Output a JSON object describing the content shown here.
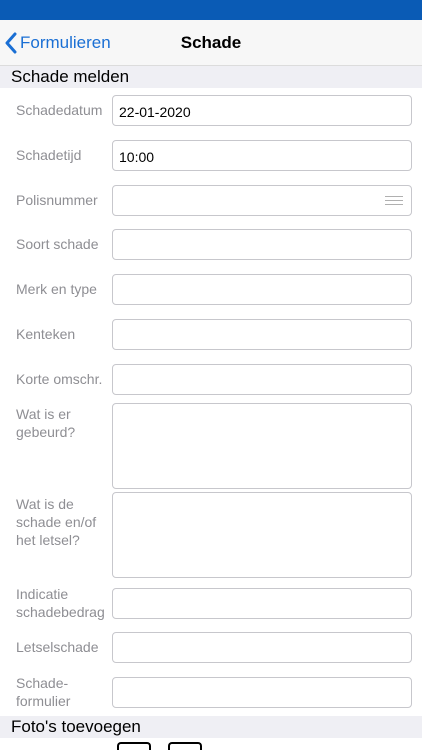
{
  "nav": {
    "back_label": "Formulieren",
    "title": "Schade"
  },
  "sections": {
    "report": "Schade melden",
    "photos": "Foto's toevoegen"
  },
  "fields": {
    "damage_date": {
      "label": "Schadedatum",
      "value": "22-01-2020"
    },
    "damage_time": {
      "label": "Schadetijd",
      "value": "10:00"
    },
    "policy_number": {
      "label": "Polisnummer",
      "value": ""
    },
    "damage_type": {
      "label": "Soort schade",
      "value": ""
    },
    "make_model": {
      "label": "Merk en type",
      "value": ""
    },
    "license_plate": {
      "label": "Kenteken",
      "value": ""
    },
    "short_description": {
      "label": "Korte omschr.",
      "value": ""
    },
    "what_happened": {
      "label": "Wat is er gebeurd?",
      "value": ""
    },
    "damage_injury": {
      "label": "Wat is de schade en/of het letsel?",
      "value": ""
    },
    "damage_amount": {
      "label": "Indicatie schadebedrag",
      "value": ""
    },
    "injury": {
      "label": "Letselschade",
      "value": ""
    },
    "claim_form": {
      "label": "Schade-formulier",
      "value": ""
    }
  },
  "colors": {
    "status_bar": "#0a5bb5",
    "accent": "#1a6fd4",
    "label": "#8e8e93"
  }
}
